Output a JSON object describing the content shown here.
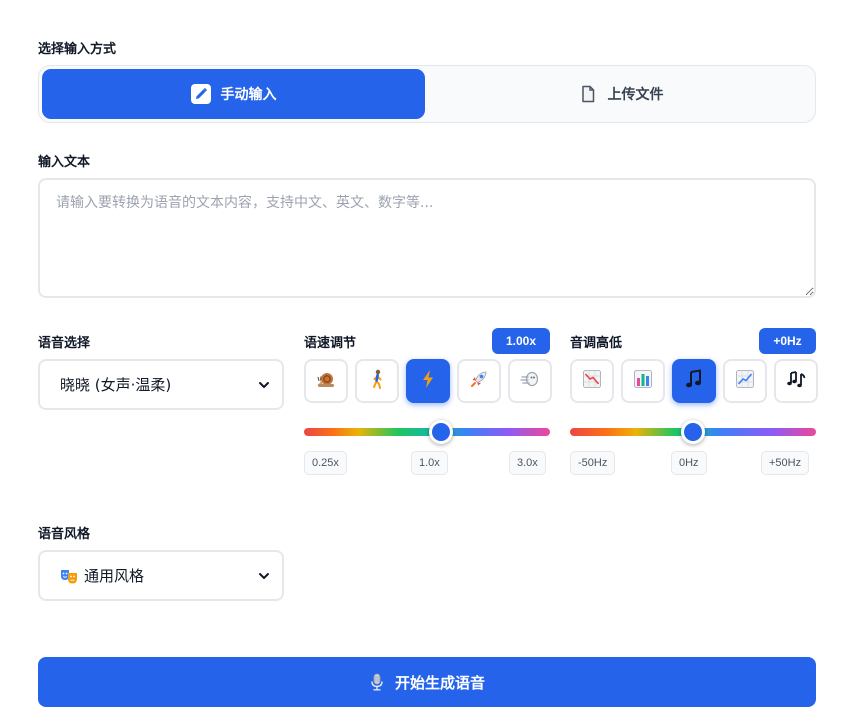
{
  "input_method": {
    "label": "选择输入方式",
    "options": [
      {
        "label": "手动输入",
        "icon": "pencil-icon",
        "active": true
      },
      {
        "label": "上传文件",
        "icon": "file-icon",
        "active": false
      }
    ]
  },
  "text_input": {
    "label": "输入文本",
    "value": "",
    "placeholder": "请输入要转换为语音的文本内容，支持中文、英文、数字等..."
  },
  "voice": {
    "label": "语音选择",
    "selected": "晓晓 (女声·温柔)"
  },
  "speed": {
    "label": "语速调节",
    "value_badge": "1.00x",
    "value": 1.0,
    "min": 0.25,
    "max": 3.0,
    "presets": [
      {
        "icon": "snail-icon",
        "active": false
      },
      {
        "icon": "walking-person-icon",
        "active": false
      },
      {
        "icon": "lightning-icon",
        "active": true
      },
      {
        "icon": "rocket-icon",
        "active": false
      },
      {
        "icon": "wind-icon",
        "active": false
      }
    ],
    "ticks": [
      "0.25x",
      "1.0x",
      "3.0x"
    ]
  },
  "pitch": {
    "label": "音调高低",
    "value_badge": "+0Hz",
    "value": 0,
    "min": -50,
    "max": 50,
    "presets": [
      {
        "icon": "chart-decreasing-icon",
        "active": false
      },
      {
        "icon": "bar-chart-icon",
        "active": false
      },
      {
        "icon": "musical-note-icon",
        "active": true
      },
      {
        "icon": "chart-increasing-icon",
        "active": false
      },
      {
        "icon": "musical-notes-icon",
        "active": false
      }
    ],
    "ticks": [
      "-50Hz",
      "0Hz",
      "+50Hz"
    ]
  },
  "style": {
    "label": "语音风格",
    "selected": "通用风格",
    "icon": "theater-masks-icon"
  },
  "generate_button": {
    "label": "开始生成语音",
    "icon": "microphone-icon"
  },
  "colors": {
    "accent": "#2563eb",
    "border": "#e5e7eb",
    "text": "#111827",
    "muted": "#9ca3af"
  }
}
